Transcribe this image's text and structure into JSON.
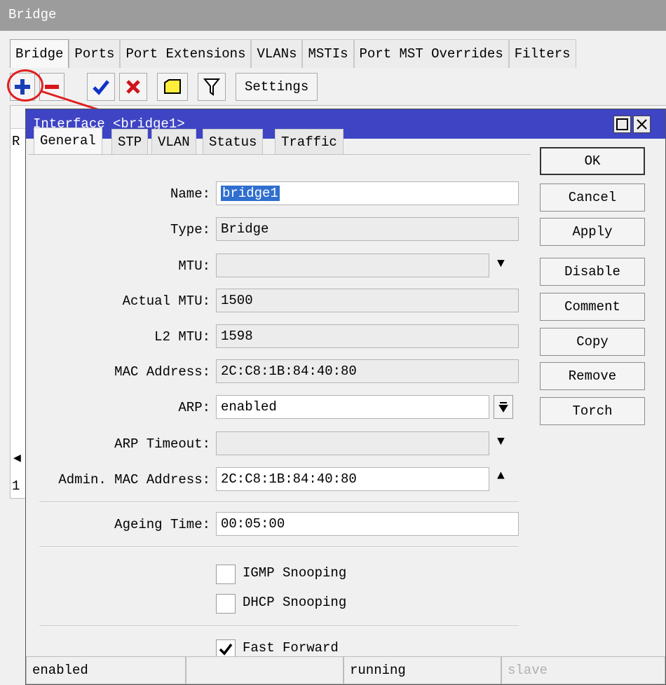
{
  "bridge_window": {
    "title": "Bridge",
    "tabs": [
      "Bridge",
      "Ports",
      "Port Extensions",
      "VLANs",
      "MSTIs",
      "Port MST Overrides",
      "Filters"
    ],
    "toolbar": {
      "add_icon": "plus-icon",
      "remove_icon": "minus-icon",
      "enable_icon": "check-icon",
      "disable_icon": "x-icon",
      "comment_icon": "note-icon",
      "filter_icon": "funnel-icon",
      "settings_label": "Settings"
    },
    "list": {
      "row_prefix": "R",
      "footer_count": "1"
    }
  },
  "dialog": {
    "title": "Interface <bridge1>",
    "tabs": [
      "General",
      "STP",
      "VLAN",
      "Status",
      "Traffic"
    ],
    "fields": {
      "name": {
        "label": "Name:",
        "value": "bridge1"
      },
      "type": {
        "label": "Type:",
        "value": "Bridge"
      },
      "mtu": {
        "label": "MTU:",
        "value": ""
      },
      "actual_mtu": {
        "label": "Actual MTU:",
        "value": "1500"
      },
      "l2_mtu": {
        "label": "L2 MTU:",
        "value": "1598"
      },
      "mac_address": {
        "label": "MAC Address:",
        "value": "2C:C8:1B:84:40:80"
      },
      "arp": {
        "label": "ARP:",
        "value": "enabled"
      },
      "arp_timeout": {
        "label": "ARP Timeout:",
        "value": ""
      },
      "admin_mac": {
        "label": "Admin. MAC Address:",
        "value": "2C:C8:1B:84:40:80"
      },
      "ageing_time": {
        "label": "Ageing Time:",
        "value": "00:05:00"
      }
    },
    "checkboxes": {
      "igmp": {
        "label": "IGMP Snooping",
        "checked": false
      },
      "dhcp": {
        "label": "DHCP Snooping",
        "checked": false
      },
      "fast_forward": {
        "label": "Fast Forward",
        "checked": true
      }
    },
    "buttons": {
      "ok": "OK",
      "cancel": "Cancel",
      "apply": "Apply",
      "disable": "Disable",
      "comment": "Comment",
      "copy": "Copy",
      "remove": "Remove",
      "torch": "Torch"
    },
    "status": [
      "enabled",
      "",
      "running",
      "slave"
    ]
  },
  "colors": {
    "dialog_title_bg": "#3e44c4",
    "highlight": "#2f6fcf",
    "annotation": "#e02020"
  }
}
